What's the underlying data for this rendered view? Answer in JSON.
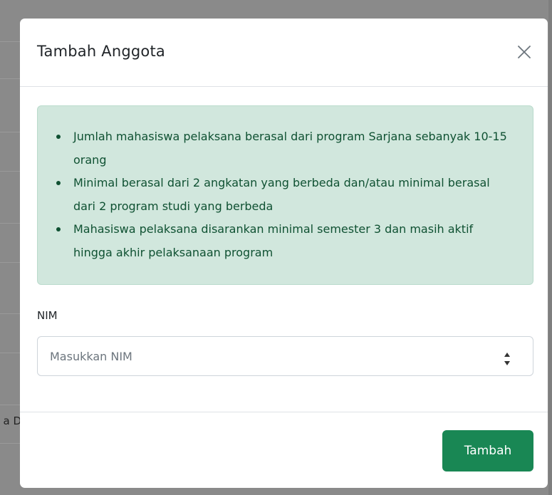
{
  "modal": {
    "title": "Tambah Anggota",
    "info_items": [
      "Jumlah mahasiswa pelaksana berasal dari program Sarjana sebanyak 10-15 orang",
      "Minimal berasal dari 2 angkatan yang berbeda dan/atau minimal berasal dari 2 program studi yang berbeda",
      "Mahasiswa pelaksana disarankan minimal semester 3 dan masih aktif hingga akhir pelaksanaan program"
    ],
    "nim_label": "NIM",
    "nim_placeholder": "Masukkan NIM",
    "nim_value": "",
    "submit_label": "Tambah"
  },
  "background": {
    "fragment_text": "a D"
  },
  "colors": {
    "overlay": "#8a8a8a",
    "alert_bg": "#d1e7dd",
    "alert_border": "#badbcc",
    "alert_text": "#0f5132",
    "primary_button": "#198754"
  },
  "icons": {
    "close": "close-icon",
    "spin_up": "chevron-up-icon",
    "spin_down": "chevron-down-icon",
    "bullet": "bullet-icon"
  }
}
